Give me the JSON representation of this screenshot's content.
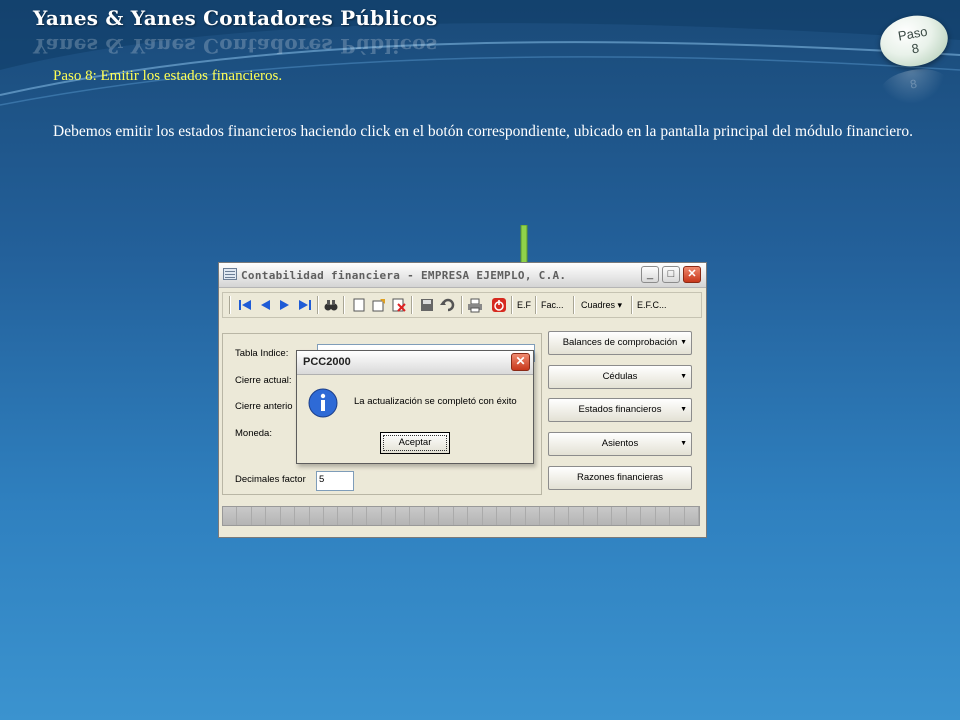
{
  "header": {
    "title": "Yanes & Yanes Contadores Públicos",
    "badge_line1": "Paso",
    "badge_line2": "8"
  },
  "content": {
    "step_title": "Paso 8: Emitir los estados financieros.",
    "description": "Debemos emitir los estados financieros haciendo click en el botón correspondiente, ubicado en la pantalla principal del módulo financiero."
  },
  "colors": {
    "accent_yellow": "#ffff55",
    "arrow_green": "#8fd24a"
  },
  "app_window": {
    "title": "Contabilidad financiera - EMPRESA EJEMPLO, C.A.",
    "title_buttons": {
      "minimize": "_",
      "maximize": "□",
      "close": "✕"
    },
    "toolbar": {
      "ef_label": "E.F",
      "fac_label": "Fac...",
      "cuadres_label": "Cuadres",
      "efc_label": "E.F.C..."
    },
    "form": {
      "tabla_indice_label": "Tabla Indice:",
      "cierre_actual_label": "Cierre actual:",
      "cierre_anterior_label": "Cierre anterio",
      "moneda_label": "Moneda:",
      "decimales_label": "Decimales factor",
      "decimales_value": "5"
    },
    "buttons": {
      "balances": "Balances de comprobación",
      "cedulas": "Cédulas",
      "estados": "Estados financieros",
      "asientos": "Asientos",
      "razones": "Razones financieras"
    }
  },
  "dialog": {
    "title": "PCC2000",
    "message": "La actualización se completó con éxito",
    "ok_button": "Aceptar",
    "close": "✕"
  }
}
